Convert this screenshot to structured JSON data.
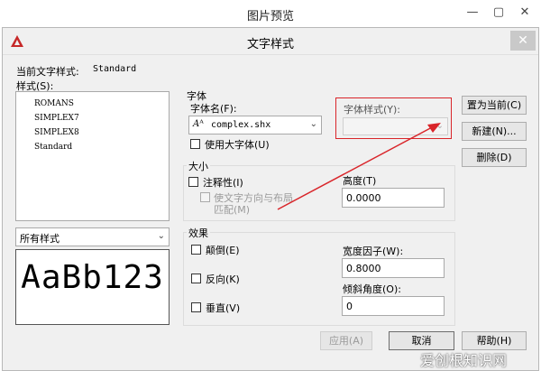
{
  "viewer": {
    "title": "图片预览",
    "minimize": "—",
    "maximize": "▢",
    "close": "✕"
  },
  "dialog": {
    "title": "文字样式",
    "close": "✕",
    "current_style_label": "当前文字样式:",
    "current_style_value": "Standard",
    "styles_label": "样式(S):",
    "styles": [
      "ROMANS",
      "SIMPLEX7",
      "SIMPLEX8",
      "Standard"
    ],
    "filter_value": "所有样式",
    "preview_text": "AaBb123",
    "font": {
      "group_label": "字体",
      "name_label": "字体名(F):",
      "name_value": "complex.shx",
      "style_label": "字体样式(Y):",
      "style_value": "",
      "bigfont_label": "使用大字体(U)"
    },
    "size": {
      "group_label": "大小",
      "annotative_label": "注释性(I)",
      "match_orientation_line1": "使文字方向与布局",
      "match_orientation_line2": "匹配(M)",
      "height_label": "高度(T)",
      "height_value": "0.0000"
    },
    "effects": {
      "group_label": "效果",
      "upside_down_label": "颠倒(E)",
      "backwards_label": "反向(K)",
      "vertical_label": "垂直(V)",
      "width_factor_label": "宽度因子(W):",
      "width_factor_value": "0.8000",
      "oblique_label": "倾斜角度(O):",
      "oblique_value": "0"
    },
    "buttons": {
      "set_current": "置为当前(C)",
      "new": "新建(N)...",
      "delete": "删除(D)",
      "apply": "应用(A)",
      "cancel": "取消",
      "help": "帮助(H)"
    }
  },
  "watermark": "爱创根知识网",
  "colors": {
    "highlight_box": "#d9252a",
    "arrow": "#d9252a",
    "app_icon": "#c62828"
  },
  "icons": {
    "app": "autocad-icon",
    "font": "truetype-font-icon"
  }
}
